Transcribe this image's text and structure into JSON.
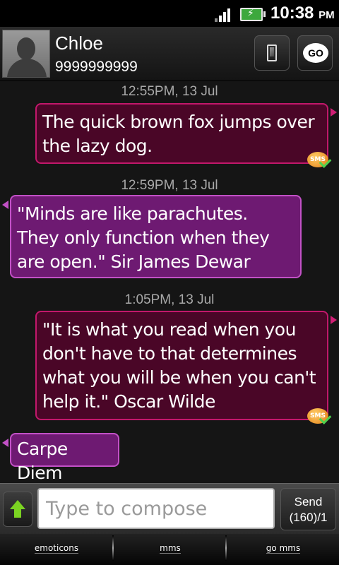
{
  "status_bar": {
    "time": "10:38",
    "ampm": "PM",
    "icons": [
      "signal-icon",
      "battery-charging-icon"
    ]
  },
  "contact": {
    "name": "Chloe",
    "number": "9999999999",
    "avatar_icon": "default-person-icon",
    "actions": [
      "phone-icon",
      "go-sms-icon"
    ],
    "go_label": "GO"
  },
  "messages": [
    {
      "timestamp": "12:55PM, 13 Jul",
      "direction": "sent",
      "text": "The quick brown fox jumps over the lazy dog.",
      "status_icon": "sms-delivered-icon"
    },
    {
      "timestamp": "12:59PM, 13 Jul",
      "direction": "received",
      "text": "\"Minds are like parachutes. They only function when they are open.\" Sir James Dewar"
    },
    {
      "timestamp": "1:05PM, 13 Jul",
      "direction": "sent",
      "text": "\"It is what you read when you don't have to that determines what you will be when you can't help it.\" Oscar Wilde",
      "status_icon": "sms-delivered-icon"
    },
    {
      "direction": "received",
      "text": "Carpe Diem"
    }
  ],
  "sms_badge_label": "SMS",
  "compose": {
    "placeholder": "Type to compose",
    "value": "",
    "send_label": "Send",
    "char_count": "(160)/1"
  },
  "toolbar": {
    "items": [
      "emoticons",
      "mms",
      "go mms"
    ]
  },
  "colors": {
    "sent_bubble": "#4a0627",
    "sent_border": "#c2186b",
    "received_bubble": "#6e1a72",
    "received_border": "#c251c6",
    "attach_arrow": "#7bd322"
  }
}
